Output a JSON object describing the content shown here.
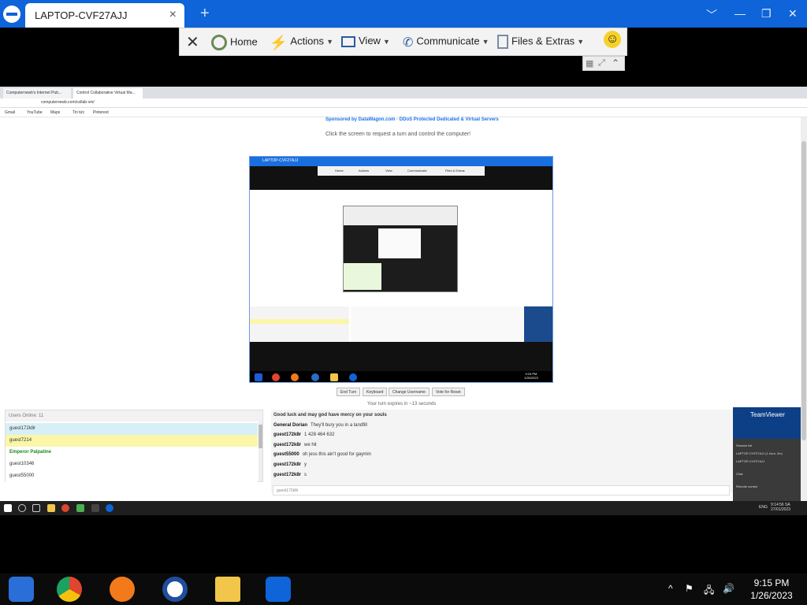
{
  "teamviewer": {
    "tab_title": "LAPTOP-CVF27AJJ",
    "tab_close": "×",
    "new_tab": "+",
    "window_controls": [
      "﹀",
      "—",
      "❐",
      "✕"
    ],
    "toolbar": {
      "close": "✕",
      "home": "Home",
      "actions": "Actions",
      "view": "View",
      "communicate": "Communicate",
      "files": "Files & Extras",
      "emoji": "☺"
    }
  },
  "remote": {
    "browser_tabs": [
      "Computernewb's Internet Pub...",
      "Control Collaborative Virtual Ma..."
    ],
    "address": "computernewb.com/collab-vm/",
    "bookmarks": [
      "Gmail",
      "YouTube",
      "Maps",
      "Tin tức",
      "Pinterest"
    ],
    "sponsor": "Sponsored by DataWagon.com · DDoS Protected Dedicated & Virtual Servers",
    "click_msg": "Click the screen to request a turn and control the computer!",
    "screen": {
      "title": "LAPTOP-CVF27AJJ",
      "toolbar": [
        "Home",
        "Actions",
        "View",
        "Communicate",
        "Files & Extras"
      ],
      "clock_time": "9:15 PM",
      "clock_date": "1/26/2023"
    },
    "buttons": [
      "End Turn",
      "Keyboard",
      "Change Username",
      "Vote for Reset"
    ],
    "turn_expires": "Your turn expires in ~13 seconds",
    "users": {
      "header": "Users Online: 11",
      "rows": [
        {
          "name": "guest172k8r",
          "bg": "#d7f0f7",
          "color": "#333"
        },
        {
          "name": "guest7214",
          "bg": "#fbf6a8",
          "color": "#333"
        },
        {
          "name": "Emperor Palpatine",
          "bg": "#ffffff",
          "color": "#1a8a1a"
        },
        {
          "name": "guest10346",
          "bg": "#ffffff",
          "color": "#333"
        },
        {
          "name": "guest55000",
          "bg": "#ffffff",
          "color": "#333"
        }
      ]
    },
    "chat": [
      {
        "user": "",
        "text": "Good luck and may god have mercy on your souls"
      },
      {
        "user": "General Dorian",
        "text": "They'll bury you in a landfill"
      },
      {
        "user": "guest172k8r",
        "text": "1 428 464 632"
      },
      {
        "user": "guest172k8r",
        "text": "we hit"
      },
      {
        "user": "guest55000",
        "text": "oh jess this ain't good for gaymin"
      },
      {
        "user": "guest172k8r",
        "text": "y"
      },
      {
        "user": "guest172k8r",
        "text": "s"
      }
    ],
    "chat_input": "guest172k8r",
    "teamviewer_panel": {
      "title": "TeamViewer",
      "rows": [
        "Session list",
        "LAPTOP-CVF27AJJ (1 hour, 2m)",
        "LAPTOP-CVF27AJJ",
        "Chat",
        "Remote control"
      ]
    },
    "taskbar_clock": "9:14:56 SA\n27/01/2023",
    "taskbar_lang": "ENG"
  },
  "local_taskbar": {
    "clock_time": "9:15 PM",
    "clock_date": "1/26/2023",
    "tray": [
      "^",
      "⚑",
      "🖧",
      "🔊"
    ]
  }
}
